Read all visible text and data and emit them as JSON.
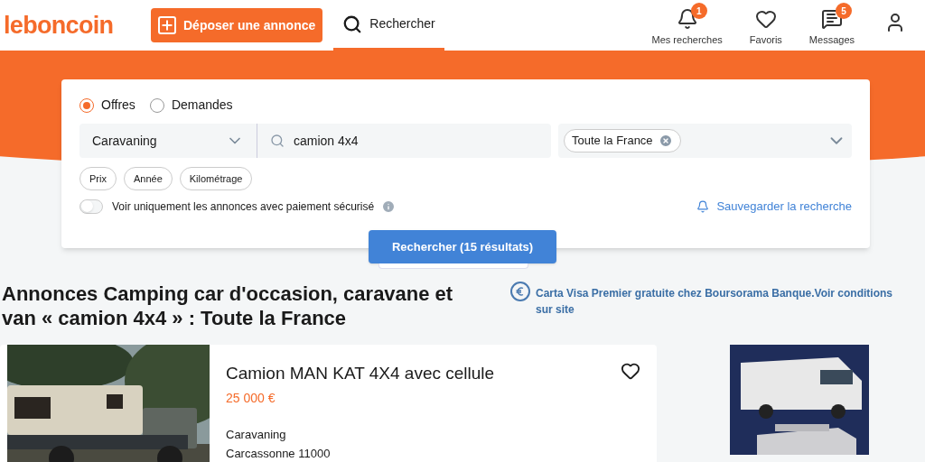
{
  "header": {
    "logo": "leboncoin",
    "post_button": "Déposer une annonce",
    "search_tab": {
      "label": "Rechercher",
      "selected": true
    },
    "nav": [
      {
        "kind": "bell",
        "label": "Mes recherches",
        "badge": "1"
      },
      {
        "kind": "heart",
        "label": "Favoris"
      },
      {
        "kind": "message",
        "label": "Messages",
        "badge": "5"
      },
      {
        "kind": "user"
      }
    ]
  },
  "search": {
    "types": [
      {
        "label": "Offres",
        "selected": true
      },
      {
        "label": "Demandes",
        "selected": false
      }
    ],
    "category": "Caravaning",
    "query": "camion 4x4",
    "location_tag": "Toute la France",
    "filters": [
      "Prix",
      "Année",
      "Kilométrage"
    ],
    "secure_toggle": {
      "label": "Voir uniquement les annonces avec paiement sécurisé",
      "on": false
    },
    "save_link": "Sauvegarder la recherche",
    "submit": "Rechercher (15 résultats)"
  },
  "results": {
    "title": "Annonces Camping car d'occasion, caravane et van « camion 4x4 » : Toute la France",
    "promo": "Carta Visa Premier gratuite chez Boursorama Banque.Voir conditions sur site",
    "listings": [
      {
        "title": "Camion MAN KAT 4X4 avec cellule",
        "price": "25 000 €",
        "category": "Caravaning",
        "location": "Carcassonne 11000",
        "favorite": false
      }
    ]
  }
}
